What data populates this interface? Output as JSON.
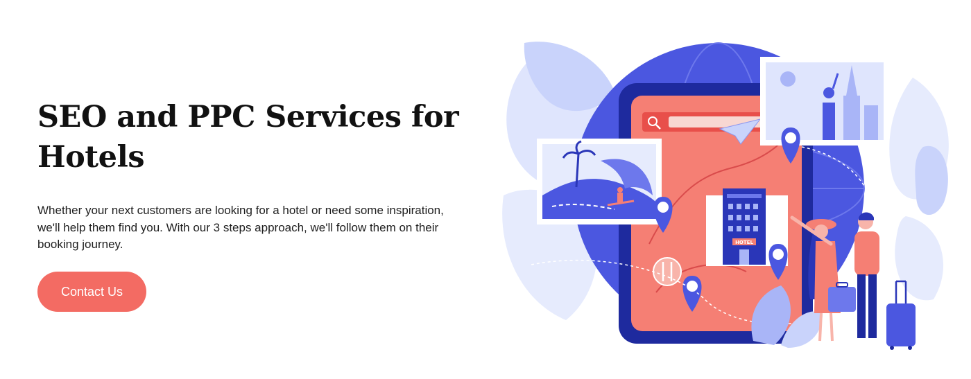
{
  "hero": {
    "title": "SEO and PPC Services for Hotels",
    "description": "Whether your next customers are looking for a hotel or need some inspiration, we'll help them find you. With our 3 steps approach, we'll follow them on their booking journey.",
    "cta_label": "Contact Us"
  },
  "illustration": {
    "hotel_sign": "HOTEL"
  },
  "colors": {
    "accent": "#f36b63",
    "brand_blue": "#4b57e0",
    "light_blue": "#c9d3fb"
  },
  "icons": [
    "search-icon",
    "paper-plane-icon",
    "map-pin-icon",
    "cutlery-icon",
    "suitcase-icon"
  ]
}
